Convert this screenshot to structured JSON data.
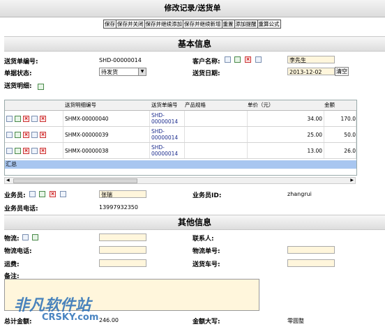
{
  "window": {
    "title": "修改记录/送货单"
  },
  "toolbar": {
    "buttons": [
      "保存",
      "保存并关闭",
      "保存并继续添加",
      "保存并继续新增",
      "重置",
      "添加提醒",
      "重算公式"
    ]
  },
  "sections": {
    "basic": "基本信息",
    "other": "其他信息"
  },
  "basic": {
    "order_no_label": "送货单编号:",
    "order_no": "SHD-00000014",
    "customer_label": "客户名称:",
    "customer": "李先生",
    "status_label": "单据状态:",
    "status": "待发货",
    "date_label": "送货日期:",
    "date": "2013-12-02",
    "date_clear": "清空",
    "details_label": "送货明细:"
  },
  "grid": {
    "columns": [
      "送货明细编号",
      "送货单编号",
      "产品规格",
      "单价（元）",
      "金额"
    ],
    "rows": [
      {
        "detail_no": "SHMX-00000040",
        "order_no": "SHD-00000014",
        "spec": "",
        "price": "34.00",
        "amount": "170.0"
      },
      {
        "detail_no": "SHMX-00000039",
        "order_no": "SHD-00000014",
        "spec": "",
        "price": "25.00",
        "amount": "50.0"
      },
      {
        "detail_no": "SHMX-00000038",
        "order_no": "SHD-00000014",
        "spec": "",
        "price": "13.00",
        "amount": "26.0"
      }
    ],
    "summary_label": "汇总"
  },
  "staff": {
    "salesman_label": "业务员:",
    "salesman": "张瑞",
    "salesman_id_label": "业务员ID:",
    "salesman_id": "zhangrui",
    "phone_label": "业务员电话:",
    "phone": "13997932350"
  },
  "other": {
    "logistics_label": "物流:",
    "contact_label": "联系人:",
    "logistics_phone_label": "物流电话:",
    "logistics_no_label": "物流单号:",
    "freight_label": "运费:",
    "car_no_label": "送货车号:",
    "note_label": "备注:",
    "total_label": "总计金额:",
    "total": "246.00",
    "total_upper_label": "金额大写:",
    "total_upper": "零圆整"
  },
  "watermark": {
    "text": "非凡软件站",
    "sub": "CRSKY.com"
  }
}
